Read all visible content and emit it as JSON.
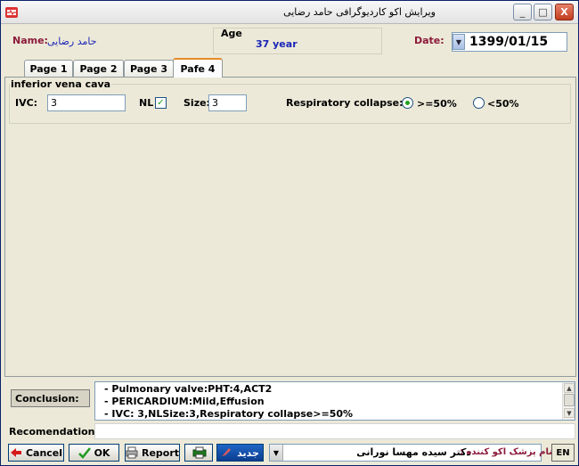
{
  "window": {
    "title": "ویرایش اکو کاردیوگرافی حامد رضایی",
    "controls": {
      "minimize": "_",
      "maximize": "□",
      "close": "X"
    }
  },
  "patient": {
    "name_label": "Name:",
    "name_value": "حامد رضایی",
    "age_label": "Age",
    "age_value": "37 year",
    "date_label": "Date:",
    "date_value": "1399/01/15"
  },
  "tabs": [
    {
      "label": "Page 1",
      "active": false
    },
    {
      "label": "Page 2",
      "active": false
    },
    {
      "label": "Page 3",
      "active": false
    },
    {
      "label": "Pafe 4",
      "active": true
    }
  ],
  "ivc_section": {
    "title": "inferior vena cava",
    "ivc_label": "IVC:",
    "ivc_value": "3",
    "nl_label": "NL",
    "nl_checked": true,
    "size_label": "Size:",
    "size_value": "3",
    "collapse_label": "Respiratory collapse:",
    "collapse_options": [
      {
        "label": ">=50%",
        "selected": true
      },
      {
        "label": "<50%",
        "selected": false
      }
    ]
  },
  "conclusion": {
    "label": "Conclusion:",
    "lines": [
      "- Pulmonary valve:PHT:4,ACT2",
      "- PERICARDIUM:Mild,Effusion",
      "- IVC: 3,NLSize:3,Respiratory collapse>=50%"
    ]
  },
  "recommendation": {
    "label": "Recomendation:",
    "value": ""
  },
  "footer": {
    "cancel_label": "Cancel",
    "ok_label": "OK",
    "report_label": "Report",
    "new_label": "جدید",
    "doctor_label": "نام پزشک اکو کننده :",
    "doctor_value": "دکتر سیده مهسا نورانی",
    "lang_label": "EN"
  },
  "colors": {
    "label_maroon": "#8b1a3a",
    "value_blue": "#1a24b8",
    "check_green": "#21a121",
    "button_blue": "#0b3d8f"
  }
}
